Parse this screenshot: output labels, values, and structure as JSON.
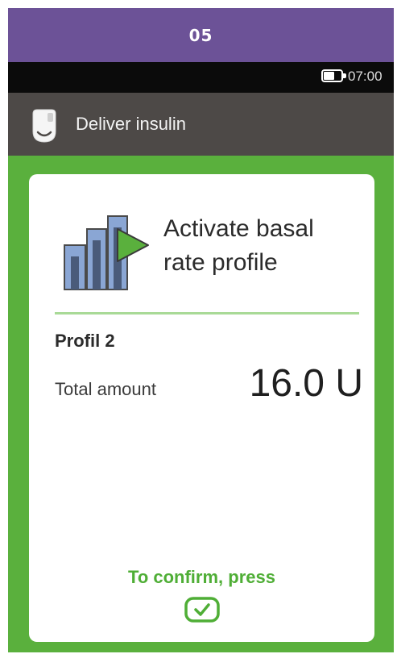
{
  "step": {
    "number": "05"
  },
  "status_bar": {
    "time": "07:00",
    "battery_icon": "battery-icon",
    "battery_level": 0.6
  },
  "title_bar": {
    "icon": "insulin-pump-icon",
    "title": "Deliver insulin"
  },
  "card": {
    "icon": "basal-rate-play-icon",
    "heading_line1": "Activate basal",
    "heading_line2": "rate profile",
    "profile_name": "Profil 2",
    "total_label": "Total amount",
    "total_value": "16.0 U",
    "confirm_text": "To confirm, press",
    "confirm_icon": "checkmark-button-icon"
  },
  "colors": {
    "header_purple": "#6c5297",
    "status_black": "#0b0b0b",
    "title_gray": "#4d4947",
    "accent_green": "#5ab03d",
    "confirm_green": "#4fae36",
    "divider_green": "#a9da97",
    "icon_blue": "#8aa6d4"
  }
}
